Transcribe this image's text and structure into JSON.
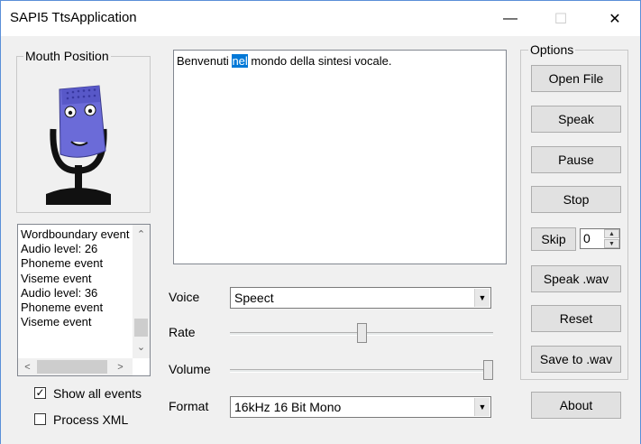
{
  "window": {
    "title": "SAPI5 TtsApplication",
    "minimize_glyph": "—",
    "maximize_glyph": "☐",
    "close_glyph": "✕"
  },
  "mouth_position": {
    "label": "Mouth Position",
    "mascot": "microphone-mascot-icon"
  },
  "events_list": {
    "items": [
      "Wordboundary event",
      "Audio level: 26",
      "Phoneme event",
      "Viseme event",
      "Audio level: 36",
      "Phoneme event",
      "Viseme event"
    ]
  },
  "checkboxes": {
    "show_all_events": {
      "label": "Show all events",
      "checked": true
    },
    "process_xml": {
      "label": "Process XML",
      "checked": false
    }
  },
  "text_input": {
    "before": "Benvenuti ",
    "selected": "nel",
    "after": " mondo della sintesi vocale."
  },
  "controls": {
    "voice_label": "Voice",
    "voice_value": "Speect",
    "rate_label": "Rate",
    "rate_level": 0.5,
    "volume_label": "Volume",
    "volume_level": 1.0,
    "format_label": "Format",
    "format_value": "16kHz 16 Bit Mono"
  },
  "options": {
    "label": "Options",
    "open_file": "Open File",
    "speak": "Speak",
    "pause": "Pause",
    "stop": "Stop",
    "skip": "Skip",
    "skip_value": "0",
    "speak_wav": "Speak .wav",
    "reset": "Reset",
    "save_wav": "Save to .wav"
  },
  "about": "About"
}
